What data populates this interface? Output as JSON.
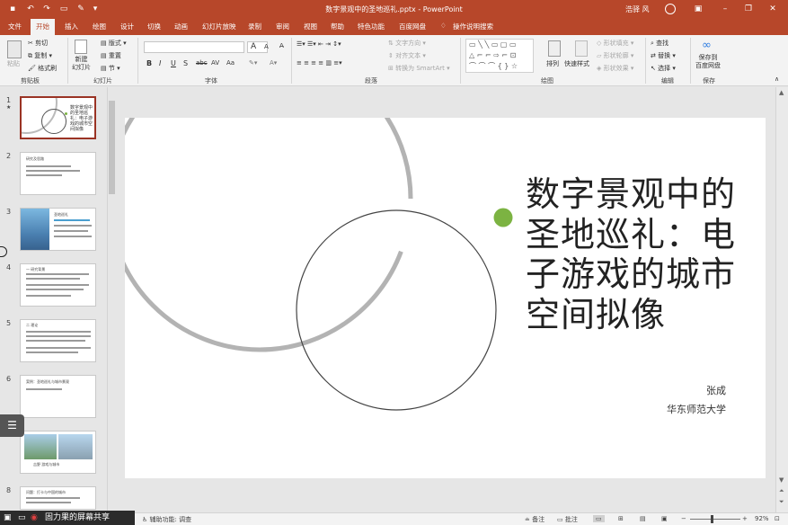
{
  "window": {
    "title": "数字景观中的圣地巡礼.pptx - PowerPoint",
    "user": "浩驿 风",
    "app_color": "#b7472a"
  },
  "tabs": [
    {
      "label": "文件"
    },
    {
      "label": "开始",
      "active": true
    },
    {
      "label": "插入"
    },
    {
      "label": "绘图"
    },
    {
      "label": "设计"
    },
    {
      "label": "切换"
    },
    {
      "label": "动画"
    },
    {
      "label": "幻灯片放映"
    },
    {
      "label": "录制"
    },
    {
      "label": "审阅"
    },
    {
      "label": "视图"
    },
    {
      "label": "帮助"
    },
    {
      "label": "特色功能"
    },
    {
      "label": "百度网盘"
    },
    {
      "label": "操作说明搜索"
    }
  ],
  "ribbon": {
    "clipboard": {
      "paste": "粘贴",
      "cut": "剪切",
      "copy": "复制",
      "format_painter": "格式刷",
      "label": "剪贴板"
    },
    "slides": {
      "new_slide": "新建\n幻灯片",
      "layout": "版式",
      "reset": "重置",
      "section": "节",
      "label": "幻灯片"
    },
    "font": {
      "label": "字体",
      "size_up": "A",
      "size_down": "A",
      "bold": "B",
      "italic": "I",
      "underline": "U",
      "shadow": "S",
      "strike": "abc",
      "spacing": "AV",
      "case": "Aa"
    },
    "paragraph": {
      "label": "段落",
      "text_direction": "文字方向",
      "align_text": "对齐文本",
      "smartart": "转换为 SmartArt"
    },
    "drawing": {
      "label": "绘图",
      "arrange": "排列",
      "quick_styles": "快速样式",
      "shape_fill": "形状填充",
      "shape_outline": "形状轮廓",
      "shape_effects": "形状效果"
    },
    "editing": {
      "label": "编辑",
      "find": "查找",
      "replace": "替换",
      "select": "选择"
    },
    "save": {
      "label": "保存",
      "save_to": "保存到\n百度网盘"
    }
  },
  "thumbnails": [
    {
      "num": "1",
      "title": "数字景观中的圣地巡礼：电子游戏的城市空间拟像",
      "selected": true
    },
    {
      "num": "2",
      "title": "研究及思路"
    },
    {
      "num": "3",
      "title": "圣地巡礼"
    },
    {
      "num": "4",
      "title": "一 研究背景"
    },
    {
      "num": "5",
      "title": "二 理论"
    },
    {
      "num": "6",
      "title": "案例：圣地巡礼与城市景观"
    },
    {
      "num": "7",
      "title": "吉野 游戏与城市"
    },
    {
      "num": "8",
      "title": "问题：打卡与中国的城市"
    }
  ],
  "slide": {
    "title": "数字景观中的圣地巡礼：电子游戏的城市空间拟像",
    "author": "张成",
    "affiliation": "华东师范大学",
    "accent_dot": "#7cb342"
  },
  "status": {
    "accessibility": "辅助功能: 调查",
    "notes": "备注",
    "comments": "批注",
    "zoom": "92%"
  },
  "overlay": {
    "share_text": "固力果的屏幕共享"
  }
}
